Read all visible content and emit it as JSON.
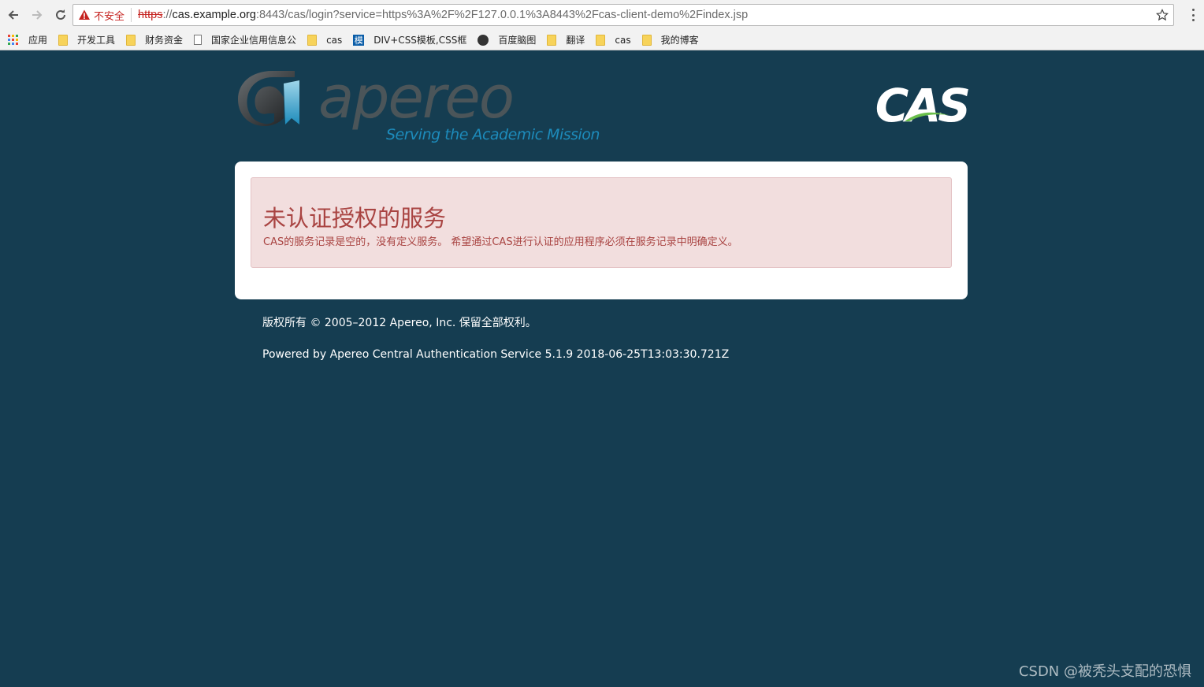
{
  "browser": {
    "security_label": "不安全",
    "url_scheme": "https",
    "url_sep": "://",
    "url_host": "cas.example.org",
    "url_rest": ":8443/cas/login?service=https%3A%2F%2F127.0.0.1%3A8443%2Fcas-client-demo%2Findex.jsp"
  },
  "bookmarks": [
    {
      "label": "应用",
      "icon": "apps-grid-icon"
    },
    {
      "label": "开发工具",
      "icon": "folder-icon"
    },
    {
      "label": "财务资金",
      "icon": "folder-icon"
    },
    {
      "label": "国家企业信用信息公",
      "icon": "page-icon"
    },
    {
      "label": "cas",
      "icon": "folder-icon"
    },
    {
      "label": "DIV+CSS模板,CSS框",
      "icon": "mo-site-icon",
      "icon_char": "模"
    },
    {
      "label": "百度脑图",
      "icon": "owl-icon"
    },
    {
      "label": "翻译",
      "icon": "folder-icon"
    },
    {
      "label": "cas",
      "icon": "folder-icon"
    },
    {
      "label": "我的博客",
      "icon": "folder-icon"
    }
  ],
  "header": {
    "logo_word": "apereo",
    "tagline": "Serving the Academic Mission",
    "cas_logo": "CAS"
  },
  "alert": {
    "title": "未认证授权的服务",
    "message": "CAS的服务记录是空的，没有定义服务。 希望通过CAS进行认证的应用程序必须在服务记录中明确定义。"
  },
  "footer": {
    "copyright": "版权所有 © 2005–2012 Apereo, Inc. 保留全部权利。",
    "powered_by": "Powered by Apereo Central Authentication Service 5.1.9 2018-06-25T13:03:30.721Z"
  },
  "watermark": "CSDN @被秃头支配的恐惧",
  "colors": {
    "page_bg": "#153d51",
    "alert_bg": "#f2dede",
    "alert_text": "#a94442",
    "tagline": "#1d8bbb"
  }
}
